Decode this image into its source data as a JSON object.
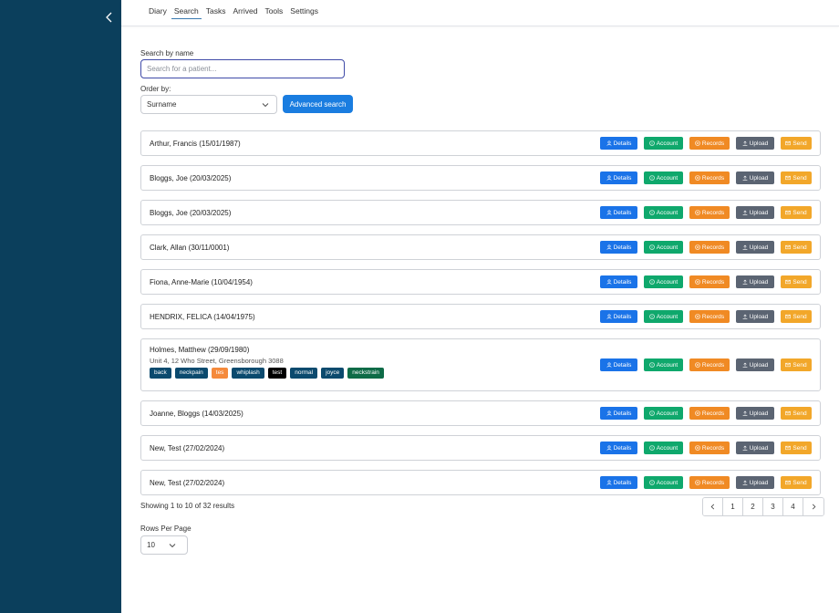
{
  "nav": {
    "tabs": [
      {
        "label": "Diary"
      },
      {
        "label": "Search"
      },
      {
        "label": "Tasks"
      },
      {
        "label": "Arrived"
      },
      {
        "label": "Tools"
      },
      {
        "label": "Settings"
      }
    ],
    "active": "Search"
  },
  "search": {
    "label": "Search by name",
    "placeholder": "Search for a patient...",
    "value": ""
  },
  "order": {
    "label": "Order by:",
    "selected": "Surname"
  },
  "advanced_label": "Advanced search",
  "action_labels": {
    "details": "Details",
    "account": "Account",
    "records": "Records",
    "upload": "Upload",
    "send": "Send"
  },
  "patients": [
    {
      "name": "Arthur, Francis  (15/01/1987)"
    },
    {
      "name": "Bloggs, Joe  (20/03/2025)"
    },
    {
      "name": "Bloggs, Joe  (20/03/2025)"
    },
    {
      "name": "Clark, Allan  (30/11/0001)"
    },
    {
      "name": "Fiona, Anne-Marie  (10/04/1954)"
    },
    {
      "name": "HENDRIX, FELICA  (14/04/1975)"
    },
    {
      "name": "Holmes, Matthew  (29/09/1980)",
      "address": "Unit 4, 12 Who Street, Greensborough 3088",
      "tags": [
        {
          "label": "back",
          "color": "#0b4a6e"
        },
        {
          "label": "neckpain",
          "color": "#0b4a6e"
        },
        {
          "label": "tes",
          "color": "#f58a3c"
        },
        {
          "label": "whiplash",
          "color": "#0b4a6e"
        },
        {
          "label": "test",
          "color": "#000000"
        },
        {
          "label": "normal",
          "color": "#0b4a6e"
        },
        {
          "label": "joyce",
          "color": "#0b4a6e"
        },
        {
          "label": "neckstrain",
          "color": "#0e6b47"
        }
      ]
    },
    {
      "name": "Joanne, Bloggs  (14/03/2025)"
    },
    {
      "name": "New, Test  (27/02/2024)"
    },
    {
      "name": "New, Test  (27/02/2024)"
    }
  ],
  "pagination": {
    "summary": "Showing 1 to 10 of 32 results",
    "pages": [
      "1",
      "2",
      "3",
      "4"
    ]
  },
  "rows_per_page": {
    "label": "Rows Per Page",
    "selected": "10"
  },
  "colors": {
    "sidebar": "#0b3f5c",
    "primary": "#1a7de0"
  }
}
